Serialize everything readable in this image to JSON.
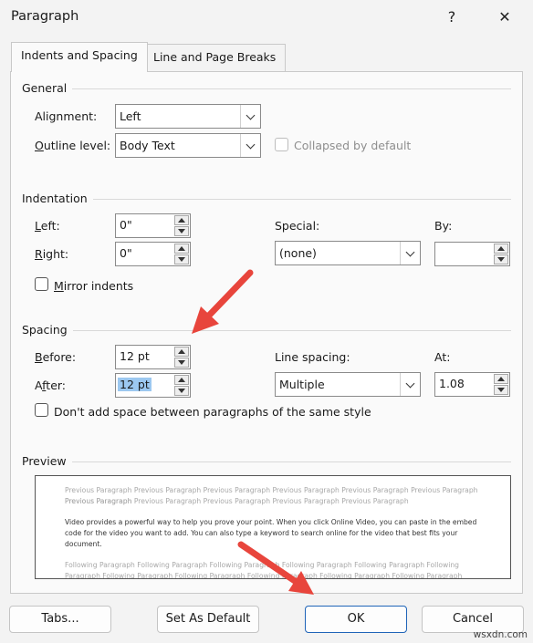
{
  "window": {
    "title": "Paragraph",
    "help": "?",
    "close": "✕"
  },
  "tabs": [
    {
      "label": "Indents and Spacing",
      "active": true
    },
    {
      "label": "Line and Page Breaks",
      "active": false
    }
  ],
  "general": {
    "section": "General",
    "alignment": {
      "label_u": "G",
      "label_rest": "Alignment:",
      "value": "Left"
    },
    "outline": {
      "label_u": "O",
      "label_rest": "utline level:",
      "value": "Body Text"
    },
    "collapsed_label": "Collapsed by default"
  },
  "indentation": {
    "section": "Indentation",
    "left": {
      "label_u": "L",
      "label_rest": "eft:",
      "value": "0\""
    },
    "right": {
      "label_u": "R",
      "label_rest": "ight:",
      "value": "0\""
    },
    "special_label": "Special:",
    "special_value": "(none)",
    "by_label": "By:",
    "by_value": "",
    "mirror_u": "M",
    "mirror_rest": "irror indents"
  },
  "spacing": {
    "section": "Spacing",
    "before": {
      "label_u": "B",
      "label_rest": "efore:",
      "value": "12 pt"
    },
    "after": {
      "label_u": "f",
      "label_pre": "A",
      "label_rest": "ter:",
      "value": "12 pt"
    },
    "line_spacing_label": "Line spacing:",
    "line_spacing_value": "Multiple",
    "at_label": "At:",
    "at_value": "1.08",
    "dont_add_label": "Don't add space between paragraphs of the same style"
  },
  "preview": {
    "section": "Preview",
    "previous_line1": "Previous Paragraph Previous Paragraph Previous Paragraph Previous Paragraph Previous Paragraph Previous Paragraph Previous Paragraph",
    "previous_line2": "Previous Paragraph Previous Paragraph Previous Paragraph Previous Paragraph Previous Paragraph",
    "body_line1": "Video provides a powerful way to help you prove your point. When you click Online Video, you can paste in the embed",
    "body_line2": "code for the video you want to add. You can also type a keyword to search online for the video that best fits your",
    "body_line3": "document.",
    "following_line1": "Following Paragraph Following Paragraph Following Paragraph Following Paragraph Following Paragraph Following",
    "following_line2": "Paragraph Following Paragraph Following Paragraph Following Paragraph Following Paragraph Following Paragraph"
  },
  "buttons": {
    "tabs": "Tabs...",
    "set_default": "Set As Default",
    "ok": "OK",
    "cancel": "Cancel"
  },
  "watermark": "wsxdn.com",
  "colors": {
    "annotation_arrow": "#e8453c",
    "default_button_border": "#1f64b8",
    "selection": "#9cc8f0"
  }
}
